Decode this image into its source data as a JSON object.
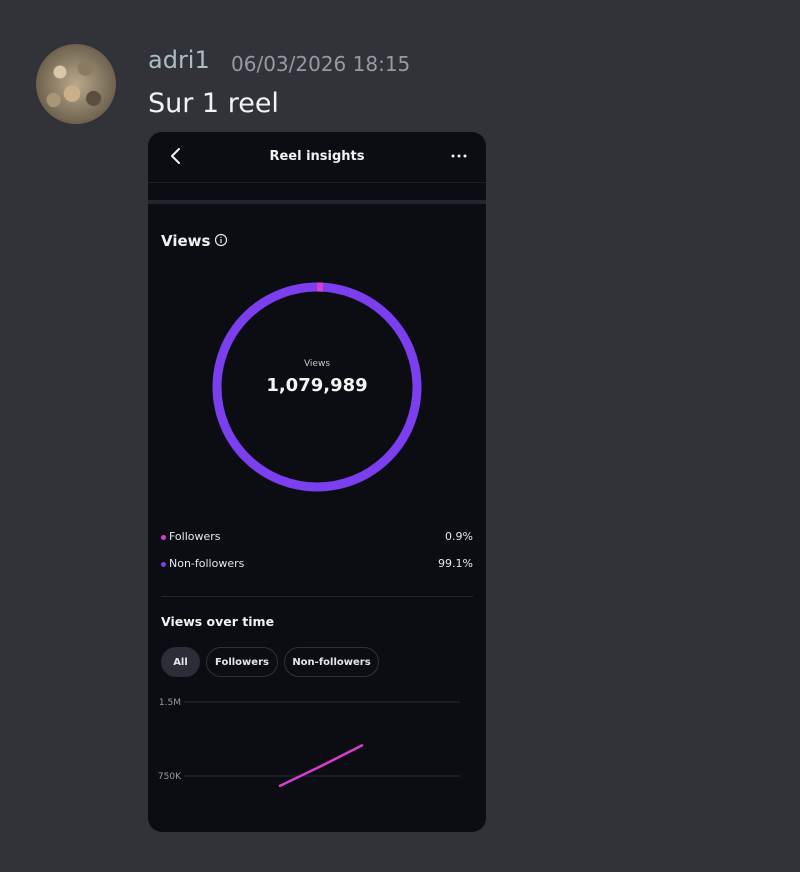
{
  "post": {
    "author": "adri1",
    "timestamp": "06/03/2026 18:15",
    "message": "Sur 1 reel"
  },
  "screen": {
    "title": "Reel insights",
    "views_heading": "Views",
    "center_label": "Views",
    "center_value": "1,079,989",
    "legend": [
      {
        "label": "Followers",
        "percent": "0.9%",
        "color": "#d63fd0"
      },
      {
        "label": "Non-followers",
        "percent": "99.1%",
        "color": "#7b3ff0"
      }
    ],
    "views_over_time_heading": "Views over time",
    "filters": [
      "All",
      "Followers",
      "Non-followers"
    ],
    "active_filter": "All"
  },
  "chart_data": {
    "type": "line",
    "series": [
      {
        "values": [
          {
            "x": 0,
            "y": 650000
          },
          {
            "x": 1,
            "y": 850000
          },
          {
            "x": 2,
            "y": 1060000
          }
        ]
      }
    ],
    "y_ticks": [
      "1.5M",
      "750K"
    ],
    "ylim": [
      0,
      1500000
    ],
    "grid": true
  },
  "colors": {
    "background": "#313338",
    "card": "#0b0d13",
    "followers": "#d63fd0",
    "non_followers": "#7b3ff0"
  }
}
